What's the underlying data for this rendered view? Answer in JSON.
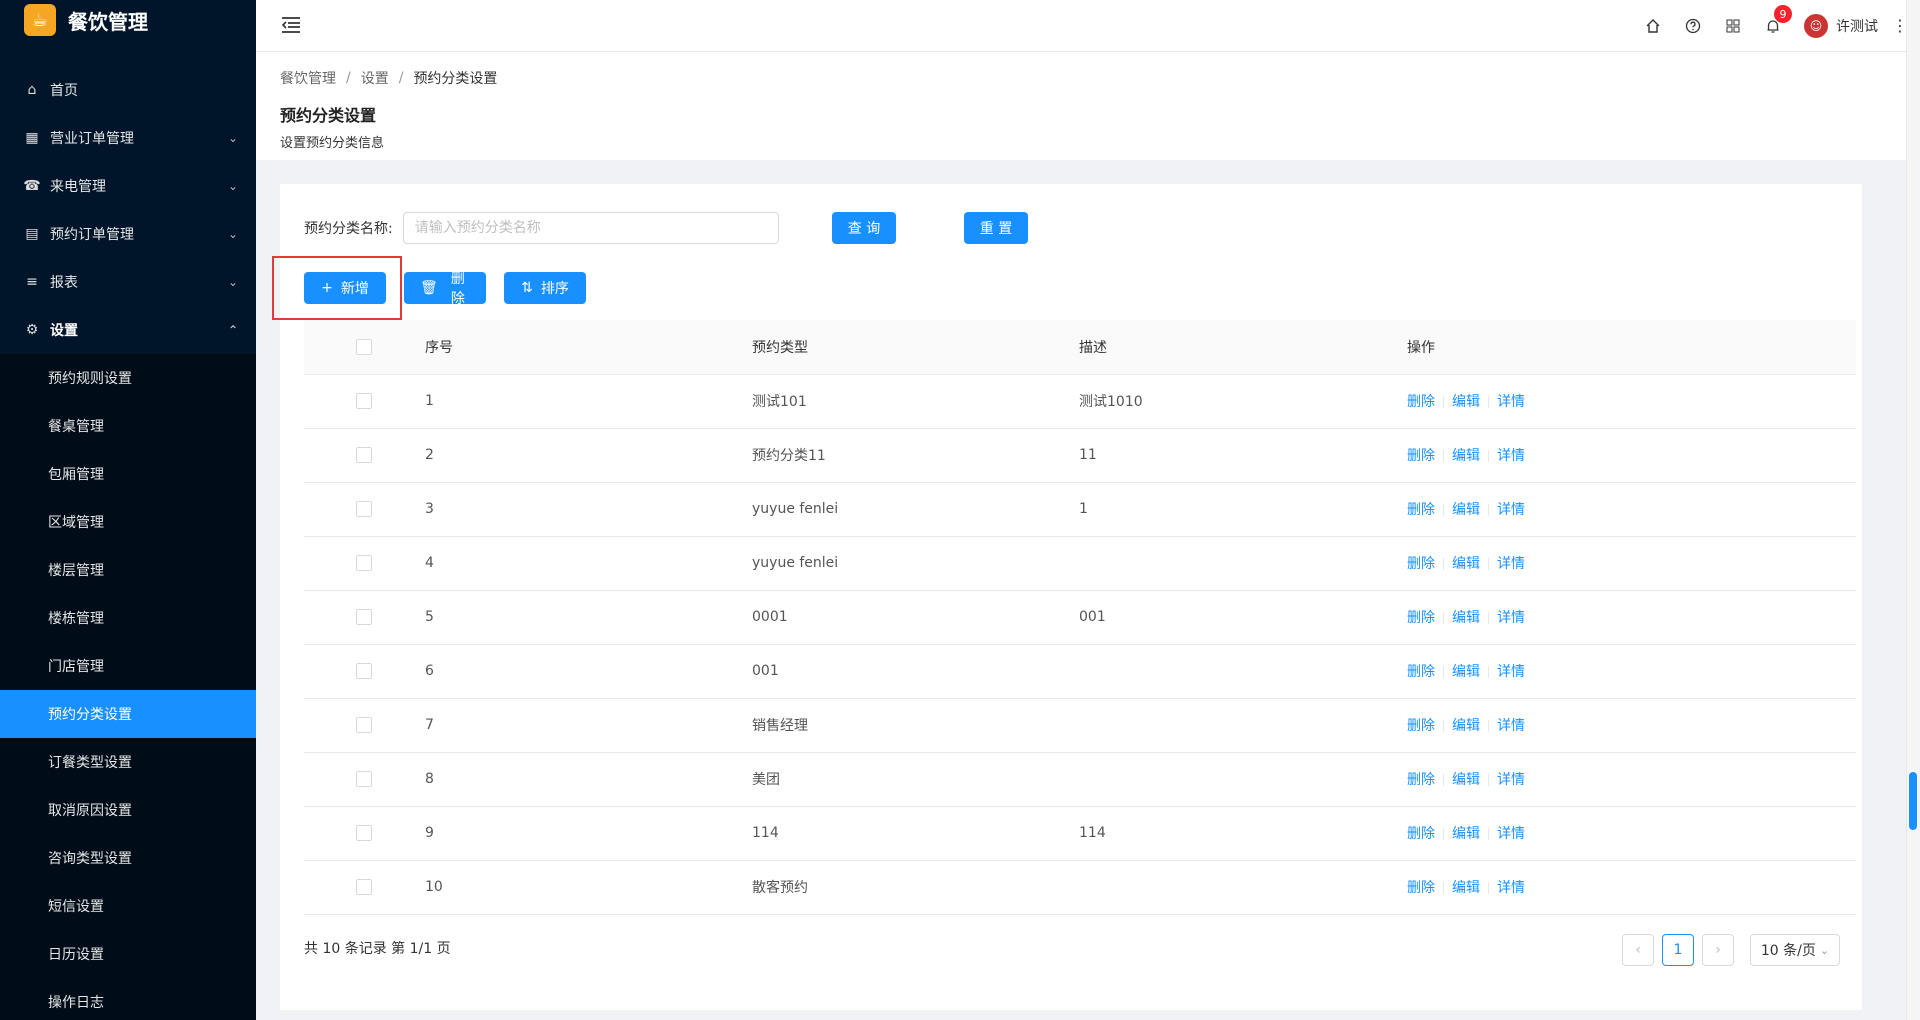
{
  "app": {
    "logo_char": "☕",
    "title": "餐饮管理"
  },
  "sidebar": {
    "top": [
      {
        "label": "首页",
        "icon": "home-icon",
        "glyph": "⌂"
      },
      {
        "label": "营业订单管理",
        "icon": "calendar-icon",
        "glyph": "▦"
      },
      {
        "label": "来电管理",
        "icon": "phone-icon",
        "glyph": "☎"
      },
      {
        "label": "预约订单管理",
        "icon": "list-icon",
        "glyph": "▤"
      },
      {
        "label": "报表",
        "icon": "menu-icon",
        "glyph": "≡"
      },
      {
        "label": "设置",
        "icon": "gear-icon",
        "glyph": "⚙"
      }
    ],
    "sub": [
      "预约规则设置",
      "餐桌管理",
      "包厢管理",
      "区域管理",
      "楼层管理",
      "楼栋管理",
      "门店管理",
      "预约分类设置",
      "订餐类型设置",
      "取消原因设置",
      "咨询类型设置",
      "短信设置",
      "日历设置",
      "操作日志"
    ]
  },
  "header": {
    "notification_count": "9",
    "user_name": "许测试"
  },
  "breadcrumb": [
    "餐饮管理",
    "设置",
    "预约分类设置"
  ],
  "page": {
    "title": "预约分类设置",
    "subtitle": "设置预约分类信息"
  },
  "search": {
    "label": "预约分类名称:",
    "placeholder": "请输入预约分类名称",
    "value": "",
    "query_label": "查 询",
    "reset_label": "重 置"
  },
  "toolbar": {
    "add_label": "新增",
    "delete_label": "删除",
    "sort_label": "排序"
  },
  "table": {
    "headers": [
      "序号",
      "预约类型",
      "描述",
      "操作"
    ],
    "ops": [
      "删除",
      "编辑",
      "详情"
    ],
    "rows": [
      {
        "seq": "1",
        "type": "测试101",
        "desc": "测试1010"
      },
      {
        "seq": "2",
        "type": "预约分类11",
        "desc": "11"
      },
      {
        "seq": "3",
        "type": "yuyue fenlei",
        "desc": "1"
      },
      {
        "seq": "4",
        "type": "yuyue fenlei",
        "desc": ""
      },
      {
        "seq": "5",
        "type": "0001",
        "desc": "001"
      },
      {
        "seq": "6",
        "type": "001",
        "desc": ""
      },
      {
        "seq": "7",
        "type": "销售经理",
        "desc": ""
      },
      {
        "seq": "8",
        "type": "美团",
        "desc": ""
      },
      {
        "seq": "9",
        "type": "114",
        "desc": "114"
      },
      {
        "seq": "10",
        "type": "散客预约",
        "desc": ""
      }
    ]
  },
  "pagination": {
    "summary": "共 10 条记录 第 1/1 页",
    "current": "1",
    "page_size": "10 条/页"
  },
  "colors": {
    "primary": "#1890ff",
    "sidebar": "#001529",
    "highlight": "#e53935"
  }
}
